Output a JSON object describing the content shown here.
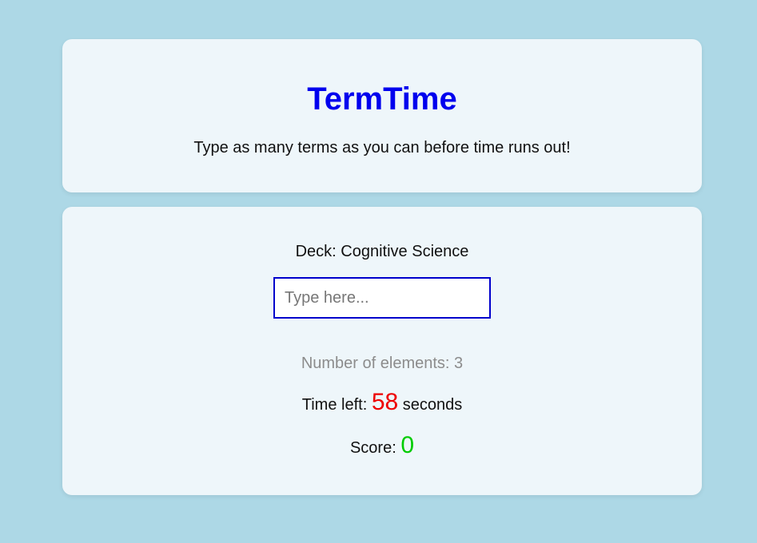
{
  "header": {
    "title": "TermTime",
    "subtitle": "Type as many terms as you can before time runs out!"
  },
  "game": {
    "deck_label": "Deck: Cognitive Science",
    "input": {
      "value": "",
      "placeholder": "Type here..."
    },
    "element_count_label": "Number of elements: 3",
    "time_prefix": "Time left: ",
    "time_value": "58",
    "time_suffix": " seconds",
    "score_prefix": "Score: ",
    "score_value": "0"
  },
  "colors": {
    "background": "#add8e6",
    "card": "#eef6fa",
    "title": "#0000ee",
    "time": "#ee0000",
    "score": "#00cc00",
    "muted": "#8c8c8c"
  }
}
